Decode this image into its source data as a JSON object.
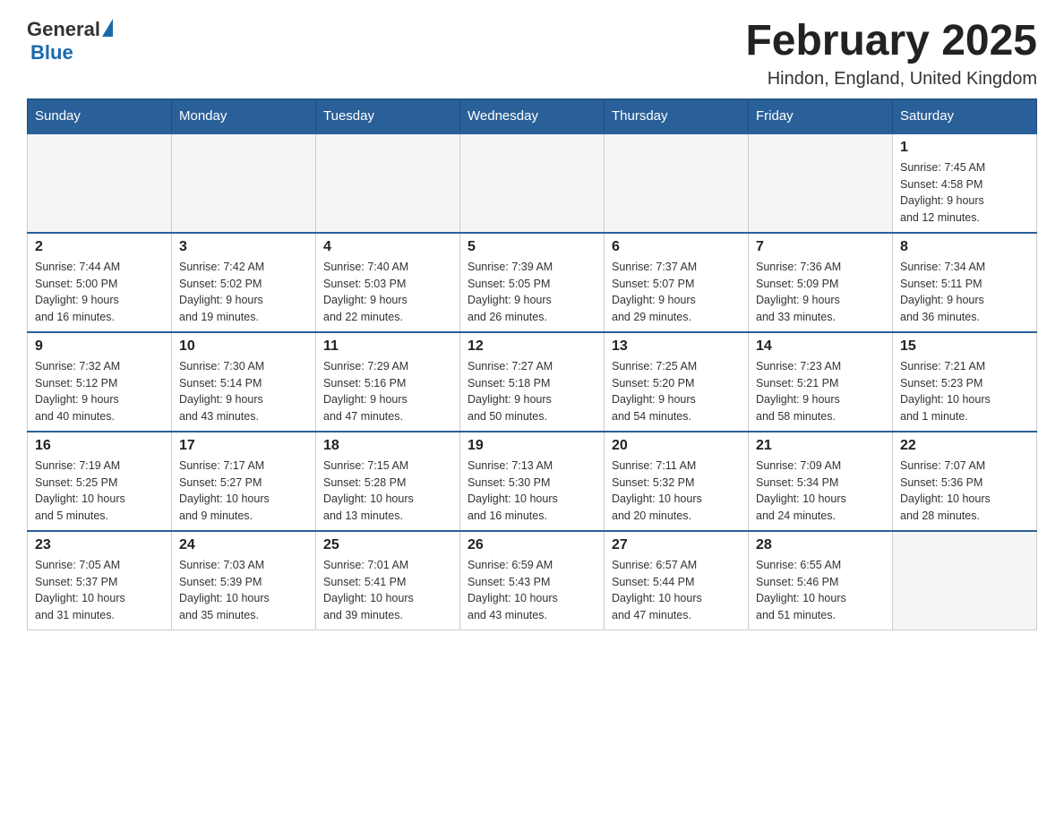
{
  "header": {
    "logo_general": "General",
    "logo_blue": "Blue",
    "title": "February 2025",
    "subtitle": "Hindon, England, United Kingdom"
  },
  "days_of_week": [
    "Sunday",
    "Monday",
    "Tuesday",
    "Wednesday",
    "Thursday",
    "Friday",
    "Saturday"
  ],
  "weeks": [
    [
      {
        "day": "",
        "info": ""
      },
      {
        "day": "",
        "info": ""
      },
      {
        "day": "",
        "info": ""
      },
      {
        "day": "",
        "info": ""
      },
      {
        "day": "",
        "info": ""
      },
      {
        "day": "",
        "info": ""
      },
      {
        "day": "1",
        "info": "Sunrise: 7:45 AM\nSunset: 4:58 PM\nDaylight: 9 hours\nand 12 minutes."
      }
    ],
    [
      {
        "day": "2",
        "info": "Sunrise: 7:44 AM\nSunset: 5:00 PM\nDaylight: 9 hours\nand 16 minutes."
      },
      {
        "day": "3",
        "info": "Sunrise: 7:42 AM\nSunset: 5:02 PM\nDaylight: 9 hours\nand 19 minutes."
      },
      {
        "day": "4",
        "info": "Sunrise: 7:40 AM\nSunset: 5:03 PM\nDaylight: 9 hours\nand 22 minutes."
      },
      {
        "day": "5",
        "info": "Sunrise: 7:39 AM\nSunset: 5:05 PM\nDaylight: 9 hours\nand 26 minutes."
      },
      {
        "day": "6",
        "info": "Sunrise: 7:37 AM\nSunset: 5:07 PM\nDaylight: 9 hours\nand 29 minutes."
      },
      {
        "day": "7",
        "info": "Sunrise: 7:36 AM\nSunset: 5:09 PM\nDaylight: 9 hours\nand 33 minutes."
      },
      {
        "day": "8",
        "info": "Sunrise: 7:34 AM\nSunset: 5:11 PM\nDaylight: 9 hours\nand 36 minutes."
      }
    ],
    [
      {
        "day": "9",
        "info": "Sunrise: 7:32 AM\nSunset: 5:12 PM\nDaylight: 9 hours\nand 40 minutes."
      },
      {
        "day": "10",
        "info": "Sunrise: 7:30 AM\nSunset: 5:14 PM\nDaylight: 9 hours\nand 43 minutes."
      },
      {
        "day": "11",
        "info": "Sunrise: 7:29 AM\nSunset: 5:16 PM\nDaylight: 9 hours\nand 47 minutes."
      },
      {
        "day": "12",
        "info": "Sunrise: 7:27 AM\nSunset: 5:18 PM\nDaylight: 9 hours\nand 50 minutes."
      },
      {
        "day": "13",
        "info": "Sunrise: 7:25 AM\nSunset: 5:20 PM\nDaylight: 9 hours\nand 54 minutes."
      },
      {
        "day": "14",
        "info": "Sunrise: 7:23 AM\nSunset: 5:21 PM\nDaylight: 9 hours\nand 58 minutes."
      },
      {
        "day": "15",
        "info": "Sunrise: 7:21 AM\nSunset: 5:23 PM\nDaylight: 10 hours\nand 1 minute."
      }
    ],
    [
      {
        "day": "16",
        "info": "Sunrise: 7:19 AM\nSunset: 5:25 PM\nDaylight: 10 hours\nand 5 minutes."
      },
      {
        "day": "17",
        "info": "Sunrise: 7:17 AM\nSunset: 5:27 PM\nDaylight: 10 hours\nand 9 minutes."
      },
      {
        "day": "18",
        "info": "Sunrise: 7:15 AM\nSunset: 5:28 PM\nDaylight: 10 hours\nand 13 minutes."
      },
      {
        "day": "19",
        "info": "Sunrise: 7:13 AM\nSunset: 5:30 PM\nDaylight: 10 hours\nand 16 minutes."
      },
      {
        "day": "20",
        "info": "Sunrise: 7:11 AM\nSunset: 5:32 PM\nDaylight: 10 hours\nand 20 minutes."
      },
      {
        "day": "21",
        "info": "Sunrise: 7:09 AM\nSunset: 5:34 PM\nDaylight: 10 hours\nand 24 minutes."
      },
      {
        "day": "22",
        "info": "Sunrise: 7:07 AM\nSunset: 5:36 PM\nDaylight: 10 hours\nand 28 minutes."
      }
    ],
    [
      {
        "day": "23",
        "info": "Sunrise: 7:05 AM\nSunset: 5:37 PM\nDaylight: 10 hours\nand 31 minutes."
      },
      {
        "day": "24",
        "info": "Sunrise: 7:03 AM\nSunset: 5:39 PM\nDaylight: 10 hours\nand 35 minutes."
      },
      {
        "day": "25",
        "info": "Sunrise: 7:01 AM\nSunset: 5:41 PM\nDaylight: 10 hours\nand 39 minutes."
      },
      {
        "day": "26",
        "info": "Sunrise: 6:59 AM\nSunset: 5:43 PM\nDaylight: 10 hours\nand 43 minutes."
      },
      {
        "day": "27",
        "info": "Sunrise: 6:57 AM\nSunset: 5:44 PM\nDaylight: 10 hours\nand 47 minutes."
      },
      {
        "day": "28",
        "info": "Sunrise: 6:55 AM\nSunset: 5:46 PM\nDaylight: 10 hours\nand 51 minutes."
      },
      {
        "day": "",
        "info": ""
      }
    ]
  ]
}
